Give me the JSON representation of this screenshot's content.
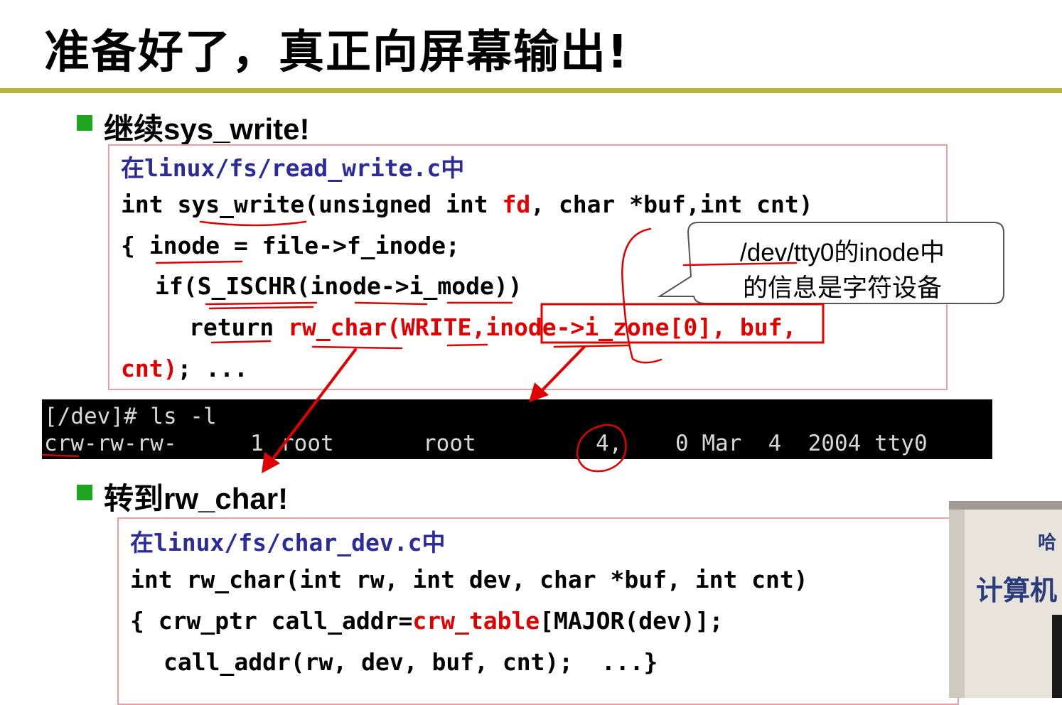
{
  "title": "准备好了，真正向屏幕输出!",
  "section1": {
    "heading": "继续sys_write!",
    "file": "在linux/fs/read_write.c中",
    "line1a": "int ",
    "line1b": "sys_write(unsigned int ",
    "line1c": "fd",
    "line1d": ", char *buf,int cnt)",
    "line2": "{ inode = file->f_inode;",
    "line3": "if(S_ISCHR(inode->i_mode))",
    "line4a": "return ",
    "line4b": "rw_char(WRITE,",
    "line4c": "inode->i_zone[0]",
    "line4d": ", buf,",
    "line5a": "cnt)",
    "line5b": "; ..."
  },
  "callout": {
    "line1": "/dev/tty0的inode中",
    "line2": "的信息是字符设备"
  },
  "terminal": {
    "line1": "[/dev]# ls -l",
    "line2_perm": "crw-rw-rw-",
    "line2_links": "1",
    "line2_owner": "root",
    "line2_group": "root",
    "line2_major": "4,",
    "line2_rest": "0 Mar  4  2004 tty0"
  },
  "section2": {
    "heading": "转到rw_char!",
    "file": "在linux/fs/char_dev.c中",
    "line1": "int rw_char(int rw, int dev, char *buf, int cnt)",
    "line2a": "{ crw_ptr call_addr=",
    "line2b": "crw_table",
    "line2c": "[MAJOR(dev)];",
    "line3": "call_addr(rw, dev, buf, cnt);  ...}"
  },
  "video": {
    "text1": "哈",
    "text2": "计算机"
  },
  "colors": {
    "accent_rule": "#b5b53a",
    "bullet": "#1fa51f",
    "annotation": "#e00000",
    "file_label": "#2b2b9a"
  }
}
